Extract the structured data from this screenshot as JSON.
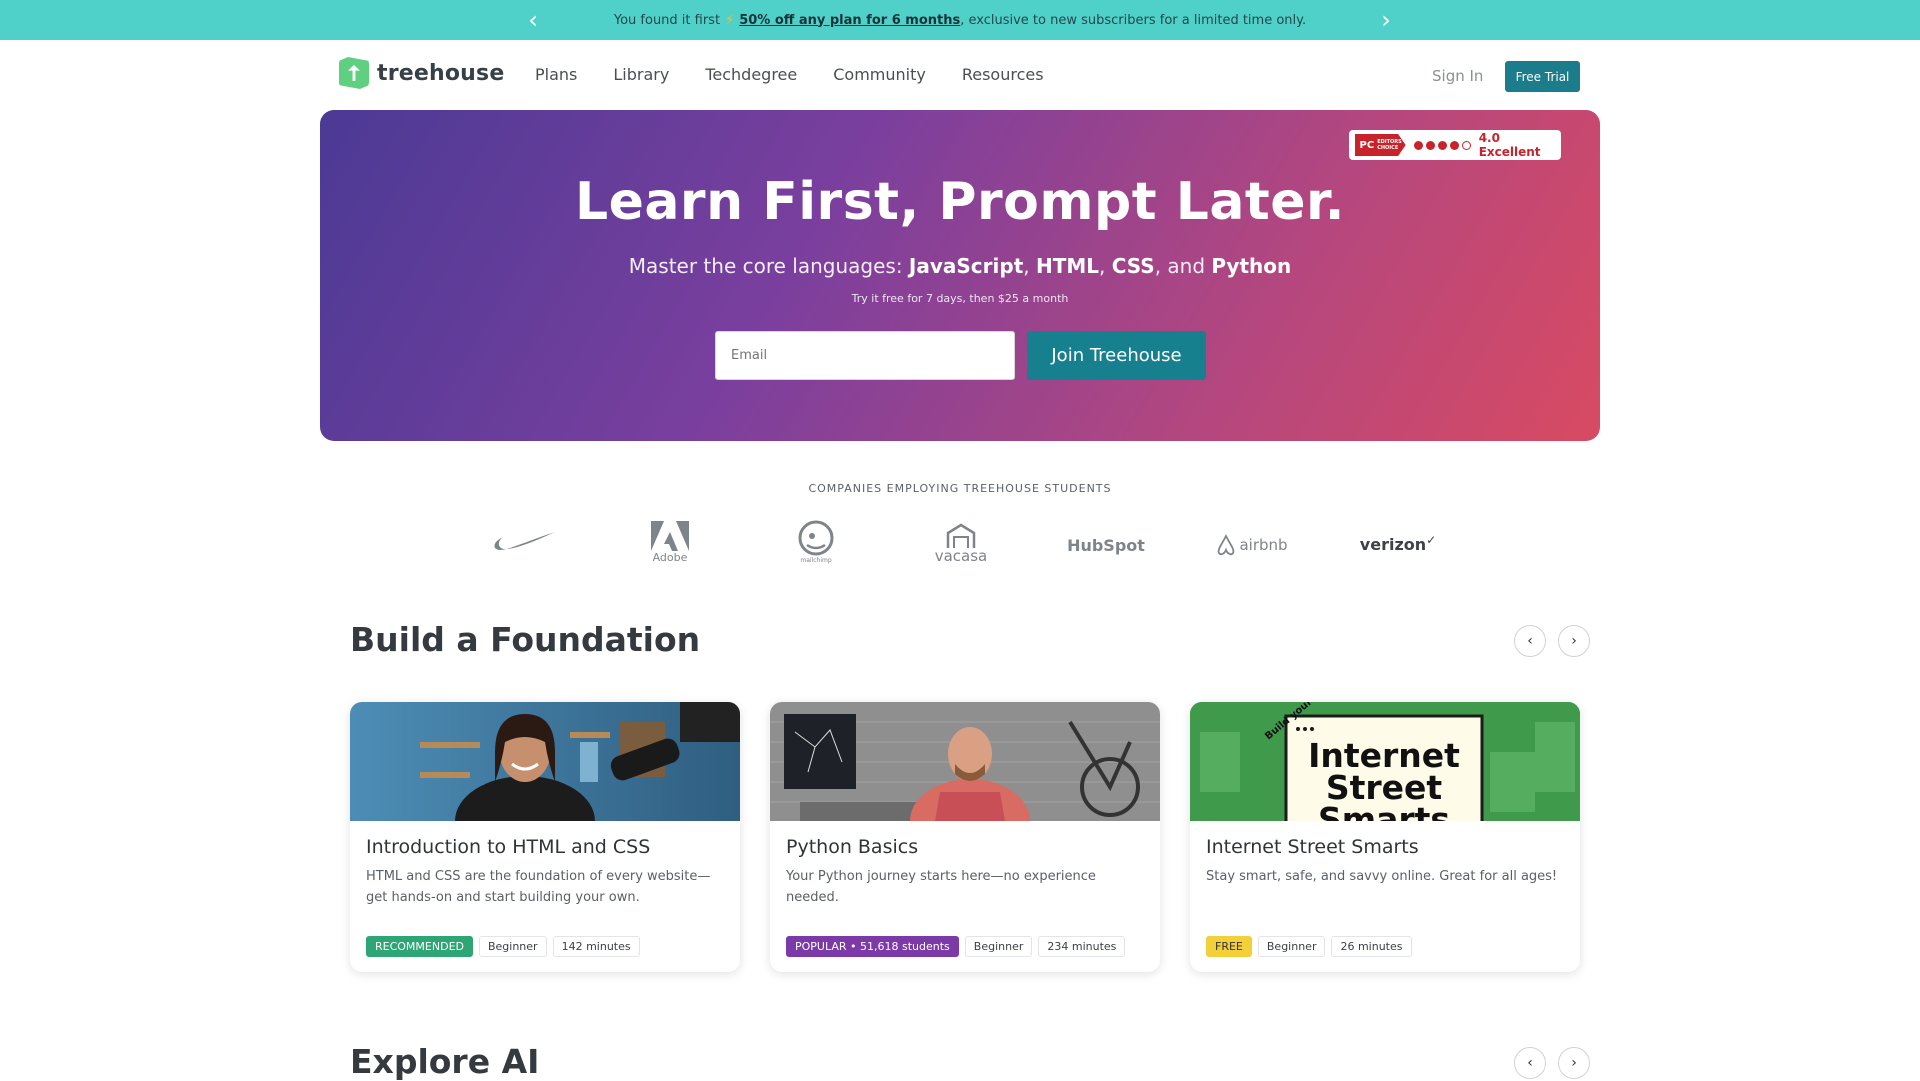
{
  "promo": {
    "prefix": "You found it first",
    "bolt": "⚡",
    "link": "50% off any plan for 6 months",
    "suffix": ", exclusive to new subscribers for a limited time only.",
    "prev_icon": "chevron-left-icon",
    "next_icon": "chevron-right-icon"
  },
  "nav": {
    "logo_text": "treehouse",
    "items": [
      "Plans",
      "Library",
      "Techdegree",
      "Community",
      "Resources"
    ],
    "signin": "Sign In",
    "free_trial": "Free Trial"
  },
  "hero": {
    "badge_pc": "PC",
    "badge_choice": "EDITORS' CHOICE",
    "rating": "4.0 Excellent",
    "title": "Learn First, Prompt Later.",
    "sub_prefix": "Master the core languages: ",
    "sub_js": "JavaScript",
    "sub_html": "HTML",
    "sub_css": "CSS",
    "sub_and": ", and ",
    "sub_py": "Python",
    "small": "Try it free for 7 days, then $25 a month",
    "email_placeholder": "Email",
    "join": "Join Treehouse"
  },
  "companies": {
    "title": "COMPANIES EMPLOYING TREEHOUSE STUDENTS",
    "logos": [
      "nike",
      "Adobe",
      "mailchimp",
      "vacasa",
      "HubSpot",
      "airbnb",
      "verizon"
    ]
  },
  "foundation": {
    "title": "Build a Foundation",
    "cards": [
      {
        "title": "Introduction to HTML and CSS",
        "desc": "HTML and CSS are the foundation of every website—get hands-on and start building your own.",
        "badge": "RECOMMENDED",
        "level": "Beginner",
        "duration": "142 minutes"
      },
      {
        "title": "Python Basics",
        "desc": "Your Python journey starts here—no experience needed.",
        "badge": "POPULAR • 51,618 students",
        "level": "Beginner",
        "duration": "234 minutes"
      },
      {
        "title": "Internet Street Smarts",
        "desc": "Stay smart, safe, and savvy online. Great for all ages!",
        "badge": "FREE",
        "level": "Beginner",
        "duration": "26 minutes",
        "thumb_line1": "Internet",
        "thumb_line2": "Street",
        "thumb_line3": "Smarts",
        "thumb_curve": "Build your"
      }
    ]
  },
  "explore": {
    "title": "Explore AI"
  }
}
